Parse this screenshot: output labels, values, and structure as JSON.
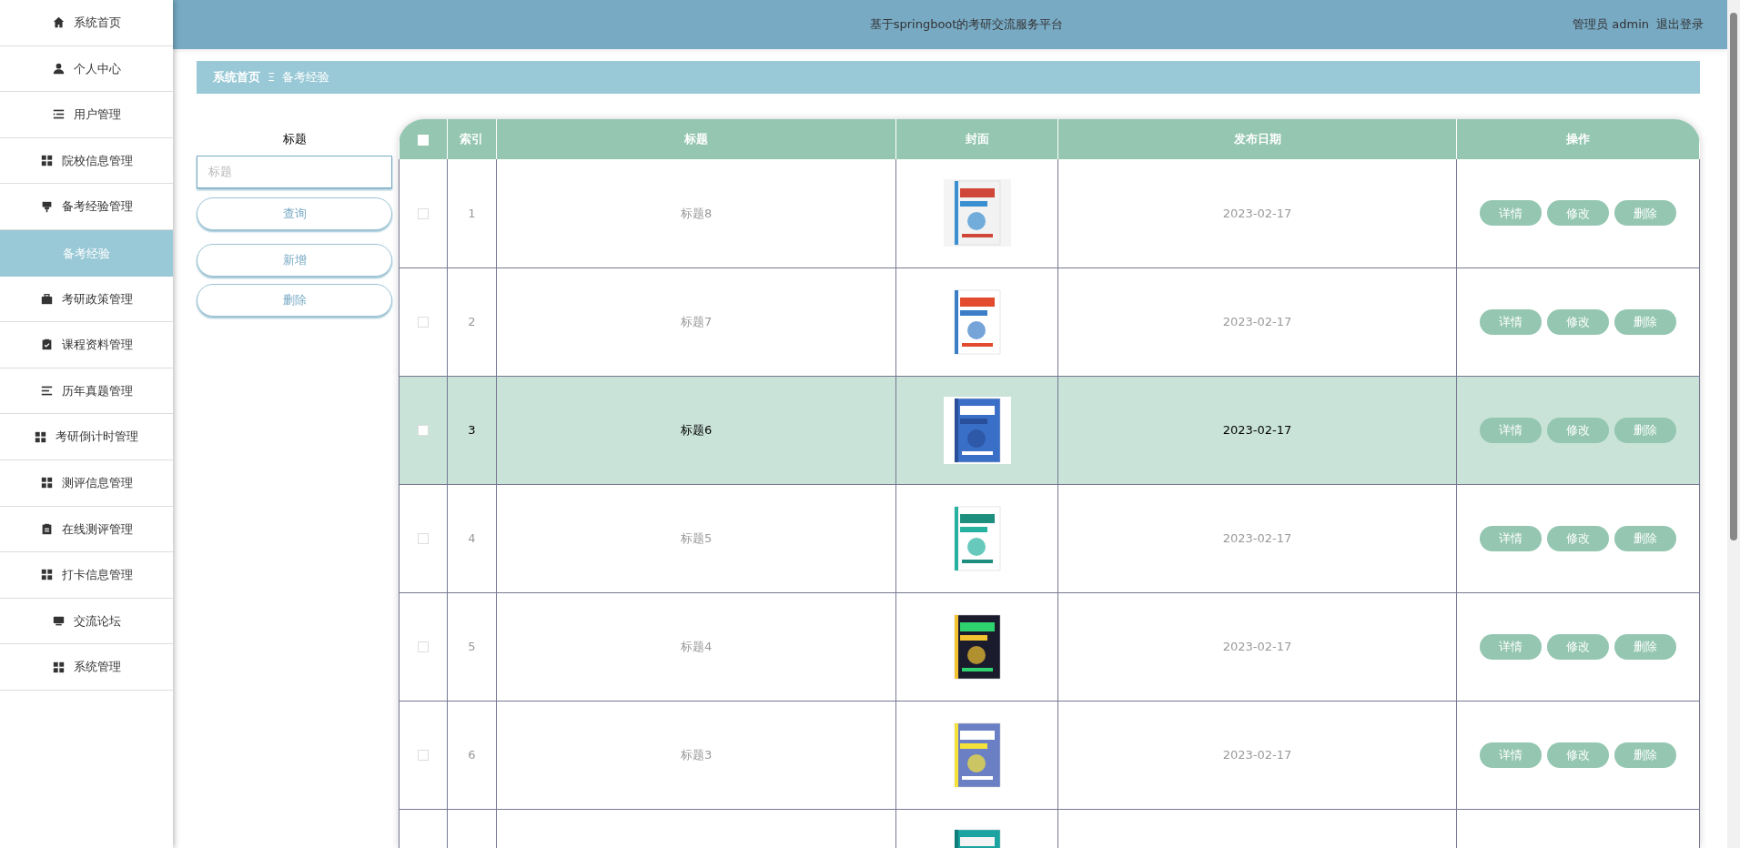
{
  "sidebar": {
    "items": [
      {
        "label": "系统首页",
        "selected": false
      },
      {
        "label": "个人中心",
        "selected": false
      },
      {
        "label": "用户管理",
        "selected": false
      },
      {
        "label": "院校信息管理",
        "selected": false
      },
      {
        "label": "备考经验管理",
        "selected": false
      },
      {
        "label": "备考经验",
        "selected": true
      },
      {
        "label": "考研政策管理",
        "selected": false
      },
      {
        "label": "课程资料管理",
        "selected": false
      },
      {
        "label": "历年真题管理",
        "selected": false
      },
      {
        "label": "考研倒计时管理",
        "selected": false
      },
      {
        "label": "测评信息管理",
        "selected": false
      },
      {
        "label": "在线测评管理",
        "selected": false
      },
      {
        "label": "打卡信息管理",
        "selected": false
      },
      {
        "label": "交流论坛",
        "selected": false
      },
      {
        "label": "系统管理",
        "selected": false
      }
    ]
  },
  "header": {
    "title": "基于springboot的考研交流服务平台",
    "user": "管理员 admin",
    "logout": "退出登录"
  },
  "breadcrumb": {
    "home": "系统首页",
    "separator": "Ξ",
    "current": "备考经验"
  },
  "search": {
    "label": "标题",
    "placeholder": "标题",
    "buttons": [
      "查询",
      "新增",
      "删除"
    ]
  },
  "table": {
    "all_checked": false,
    "columns": [
      "索引",
      "标题",
      "封面",
      "发布日期",
      "操作"
    ],
    "rows": [
      {
        "index": "1",
        "title": "标题8",
        "date": "2023-02-17",
        "highlighted": false,
        "checked": false,
        "actions": [
          "详情",
          "修改",
          "删除"
        ]
      },
      {
        "index": "2",
        "title": "标题7",
        "date": "2023-02-17",
        "highlighted": false,
        "checked": false,
        "actions": [
          "详情",
          "修改",
          "删除"
        ]
      },
      {
        "index": "3",
        "title": "标题6",
        "date": "2023-02-17",
        "highlighted": true,
        "checked": false,
        "actions": [
          "详情",
          "修改",
          "删除"
        ]
      },
      {
        "index": "4",
        "title": "标题5",
        "date": "2023-02-17",
        "highlighted": false,
        "checked": false,
        "actions": [
          "详情",
          "修改",
          "删除"
        ]
      },
      {
        "index": "5",
        "title": "标题4",
        "date": "2023-02-17",
        "highlighted": false,
        "checked": false,
        "actions": [
          "详情",
          "修改",
          "删除"
        ]
      },
      {
        "index": "6",
        "title": "标题3",
        "date": "2023-02-17",
        "highlighted": false,
        "checked": false,
        "actions": [
          "详情",
          "修改",
          "删除"
        ]
      }
    ],
    "more_rows_below": true
  }
}
